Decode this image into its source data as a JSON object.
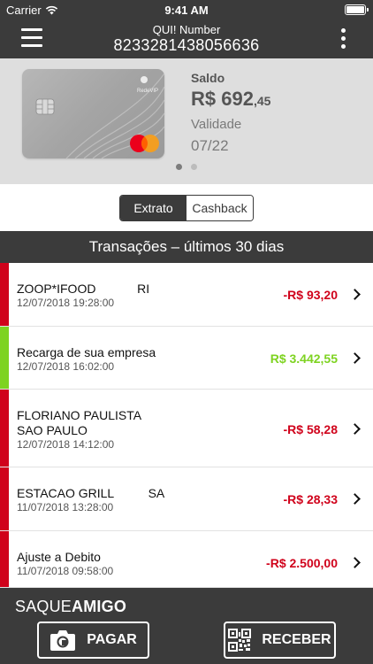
{
  "status_bar": {
    "carrier": "Carrier",
    "time": "9:41 AM"
  },
  "header": {
    "title": "QUI! Number",
    "number": "8233281438056636"
  },
  "card": {
    "brand_text": "RedeVIP"
  },
  "balance": {
    "label": "Saldo",
    "value_main": "R$ 692",
    "value_cents": ",45",
    "validity_label": "Validade",
    "validity_value": "07/22"
  },
  "tabs": [
    {
      "label": "Extrato",
      "active": true
    },
    {
      "label": "Cashback",
      "active": false
    }
  ],
  "transactions_title": "Transações – últimos 30 dias",
  "transactions": [
    {
      "description": "ZOOP*IFOOD            RI",
      "date": "12/07/2018 19:28:00",
      "amount": "-R$ 93,20",
      "type": "debit"
    },
    {
      "description": "Recarga de sua empresa",
      "date": "12/07/2018 16:02:00",
      "amount": "R$ 3.442,55",
      "type": "credit"
    },
    {
      "description": "FLORIANO PAULISTA\nSAO PAULO",
      "date": "12/07/2018 14:12:00",
      "amount": "-R$ 58,28",
      "type": "debit"
    },
    {
      "description": "ESTACAO GRILL          SA",
      "date": "11/07/2018 13:28:00",
      "amount": "-R$ 28,33",
      "type": "debit"
    },
    {
      "description": "Ajuste a Debito",
      "date": "11/07/2018 09:58:00",
      "amount": "-R$ 2.500,00",
      "type": "debit"
    }
  ],
  "bottom": {
    "brand_light": "SAQUE",
    "brand_bold": "AMIGO",
    "pay_label": "PAGAR",
    "receive_label": "RECEBER"
  },
  "colors": {
    "header_bg": "#3b3b3b",
    "debit": "#d0021b",
    "credit": "#7ed321",
    "card_section_bg": "#dedede"
  }
}
